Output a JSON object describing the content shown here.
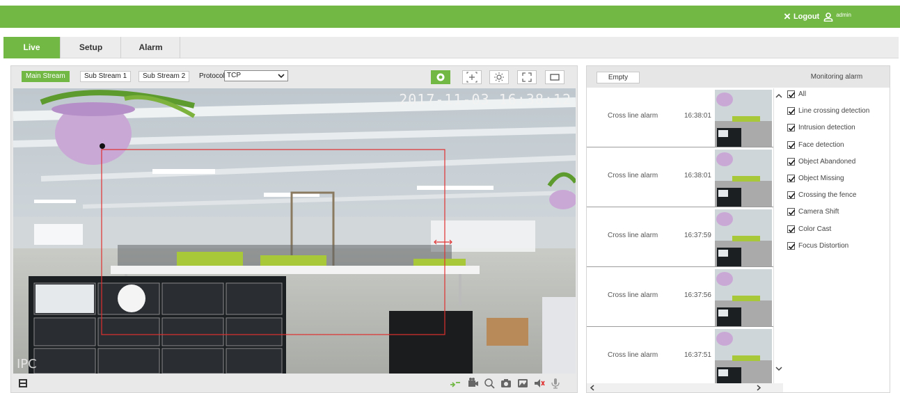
{
  "header": {
    "logout_label": "Logout",
    "username": "admin",
    "bg_color": "#72b845"
  },
  "tabs": [
    {
      "label": "Live",
      "active": true
    },
    {
      "label": "Setup",
      "active": false
    },
    {
      "label": "Alarm",
      "active": false
    }
  ],
  "stream_bar": {
    "main_stream": "Main Stream",
    "sub_stream_1": "Sub Stream 1",
    "sub_stream_2": "Sub Stream 2",
    "protocol_label": "Protocol",
    "protocol_value": "TCP"
  },
  "video": {
    "timestamp": "2017-11-03 16:38:12",
    "label": "IPC"
  },
  "alarm_panel": {
    "empty_label": "Empty",
    "monitoring_title": "Monitoring alarm",
    "alarms": [
      {
        "name": "Cross line alarm",
        "time": "16:38:01"
      },
      {
        "name": "Cross line alarm",
        "time": "16:38:01"
      },
      {
        "name": "Cross line alarm",
        "time": "16:37:59"
      },
      {
        "name": "Cross line alarm",
        "time": "16:37:56"
      },
      {
        "name": "Cross line alarm",
        "time": "16:37:51"
      }
    ],
    "monitor_options": [
      {
        "label": "All",
        "checked": true
      },
      {
        "label": "Line crossing detection",
        "checked": true
      },
      {
        "label": "Intrusion detection",
        "checked": true
      },
      {
        "label": "Face detection",
        "checked": true
      },
      {
        "label": "Object Abandoned",
        "checked": true
      },
      {
        "label": "Object Missing",
        "checked": true
      },
      {
        "label": "Crossing the fence",
        "checked": true
      },
      {
        "label": "Camera Shift",
        "checked": true
      },
      {
        "label": "Color Cast",
        "checked": true
      },
      {
        "label": "Focus Distortion",
        "checked": true
      }
    ]
  }
}
